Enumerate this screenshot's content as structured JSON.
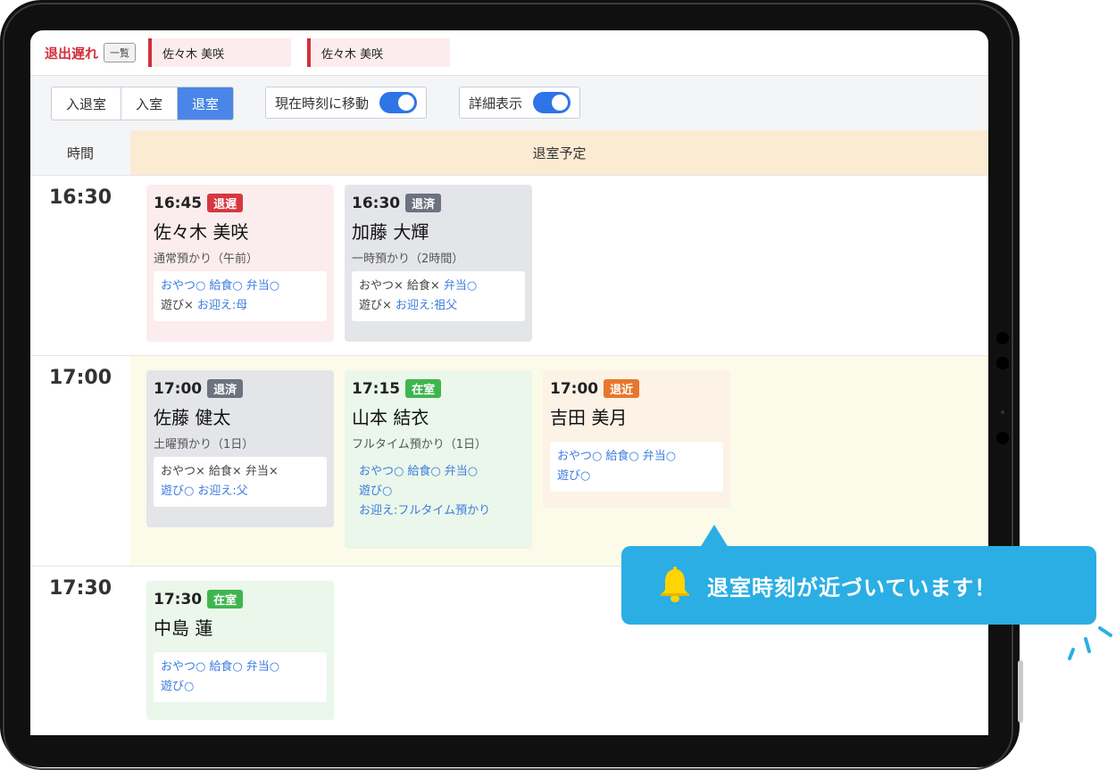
{
  "alert": {
    "title": "退出遅れ",
    "list_button": "一覧",
    "chips": [
      "佐々木 美咲",
      "佐々木 美咲"
    ]
  },
  "toolbar": {
    "segments": [
      "入退室",
      "入室",
      "退室"
    ],
    "active_segment": "退室",
    "move_to_now_label": "現在時刻に移動",
    "move_to_now_on": true,
    "detail_label": "詳細表示",
    "detail_on": true
  },
  "grid": {
    "time_header": "時間",
    "plan_header": "退室予定"
  },
  "rows": [
    {
      "time": "16:30",
      "cards": [
        {
          "time": "16:45",
          "status": "退遅",
          "status_kind": "late",
          "name": "佐々木 美咲",
          "plan": "通常預かり（午前）",
          "info_line1": [
            {
              "t": "おやつ○",
              "neg": false
            },
            {
              "t": "給食○",
              "neg": false
            },
            {
              "t": "弁当○",
              "neg": false
            }
          ],
          "info_line2": [
            {
              "t": "遊び×",
              "neg": true
            },
            {
              "t": "お迎え:母",
              "neg": false
            }
          ]
        },
        {
          "time": "16:30",
          "status": "退済",
          "status_kind": "done",
          "name": "加藤 大輝",
          "plan": "一時預かり（2時間）",
          "info_line1": [
            {
              "t": "おやつ×",
              "neg": true
            },
            {
              "t": "給食×",
              "neg": true
            },
            {
              "t": "弁当○",
              "neg": false
            }
          ],
          "info_line2": [
            {
              "t": "遊び×",
              "neg": true
            },
            {
              "t": "お迎え:祖父",
              "neg": false
            }
          ]
        }
      ]
    },
    {
      "time": "17:00",
      "cards": [
        {
          "time": "17:00",
          "status": "退済",
          "status_kind": "done",
          "name": "佐藤 健太",
          "plan": "土曜預かり（1日）",
          "info_line1": [
            {
              "t": "おやつ×",
              "neg": true
            },
            {
              "t": "給食×",
              "neg": true
            },
            {
              "t": "弁当×",
              "neg": true
            }
          ],
          "info_line2": [
            {
              "t": "遊び○",
              "neg": false
            },
            {
              "t": "お迎え:父",
              "neg": false
            }
          ]
        },
        {
          "time": "17:15",
          "status": "在室",
          "status_kind": "in",
          "name": "山本 結衣",
          "plan": "フルタイム預かり（1日）",
          "info_line1": [
            {
              "t": "おやつ○",
              "neg": false
            },
            {
              "t": "給食○",
              "neg": false
            },
            {
              "t": "弁当○",
              "neg": false
            }
          ],
          "info_line2": [
            {
              "t": "遊び○",
              "neg": false
            }
          ],
          "info_line3": [
            {
              "t": "お迎え:フルタイム預かり",
              "neg": false
            }
          ]
        },
        {
          "time": "17:00",
          "status": "退近",
          "status_kind": "near",
          "name": "吉田 美月",
          "plan": "",
          "info_line1": [
            {
              "t": "おやつ○",
              "neg": false
            },
            {
              "t": "給食○",
              "neg": false
            },
            {
              "t": "弁当○",
              "neg": false
            }
          ],
          "info_line2": [
            {
              "t": "遊び○",
              "neg": false
            }
          ]
        }
      ]
    },
    {
      "time": "17:30",
      "cards": [
        {
          "time": "17:30",
          "status": "在室",
          "status_kind": "in",
          "name": "中島 蓮",
          "plan": "",
          "info_line1": [
            {
              "t": "おやつ○",
              "neg": false
            },
            {
              "t": "給食○",
              "neg": false
            },
            {
              "t": "弁当○",
              "neg": false
            }
          ],
          "info_line2": [
            {
              "t": "遊び○",
              "neg": false
            }
          ]
        }
      ]
    }
  ],
  "notification": {
    "icon": "bell-icon",
    "text": "退室時刻が近づいています！"
  },
  "colors": {
    "accent": "#4a86e8",
    "late": "#d7373f",
    "done": "#6c727e",
    "in_room": "#3fb54f",
    "near": "#e8772b",
    "bubble": "#2baee3",
    "plan_header_bg": "#fcebd3"
  }
}
